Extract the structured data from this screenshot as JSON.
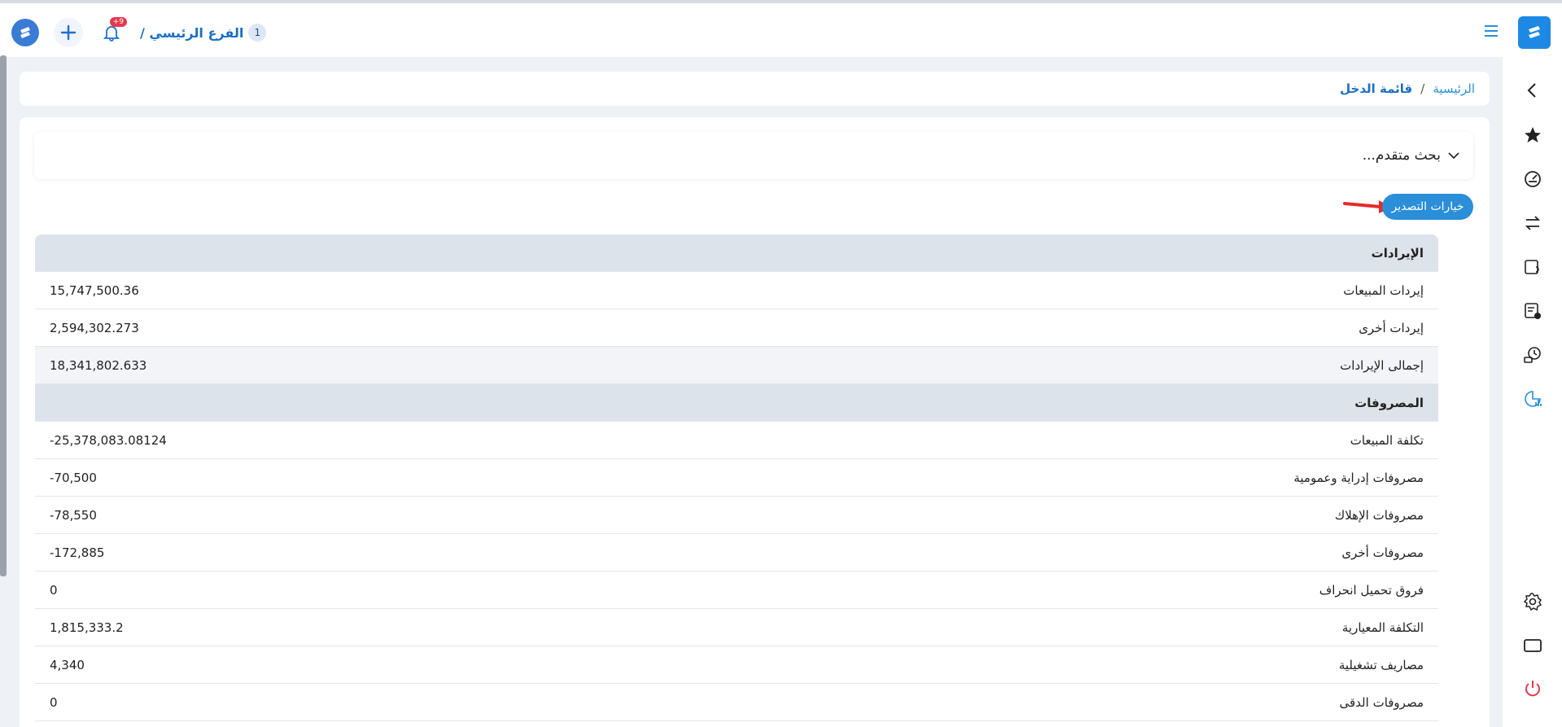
{
  "topbar": {
    "branch_label": "الفرع الرئيسي /",
    "branch_number": "1",
    "notification_badge": "+9"
  },
  "breadcrumb": {
    "home": "الرئيسية",
    "separator": "/",
    "current": "قائمة الدخل"
  },
  "search": {
    "advanced_label": "بحث متقدم..."
  },
  "export": {
    "label": "خيارات التصدير"
  },
  "table": {
    "rows": [
      {
        "type": "head",
        "label": "الإيرادات",
        "value": ""
      },
      {
        "type": "item",
        "label": "إيردات المبيعات",
        "value": "15,747,500.36"
      },
      {
        "type": "item",
        "label": "إيردات أخرى",
        "value": "2,594,302.273"
      },
      {
        "type": "total",
        "label": "إجمالى الإيرادات",
        "value": "18,341,802.633"
      },
      {
        "type": "head",
        "label": "المصروفات",
        "value": ""
      },
      {
        "type": "item",
        "label": "تكلفة المبيعات",
        "value": "-25,378,083.08124"
      },
      {
        "type": "item",
        "label": "مصروفات إدراية وعمومية",
        "value": "-70,500"
      },
      {
        "type": "item",
        "label": "مصروفات الإهلاك",
        "value": "-78,550"
      },
      {
        "type": "item",
        "label": "مصروفات أخرى",
        "value": "-172,885"
      },
      {
        "type": "item",
        "label": "فروق تحميل انحراف",
        "value": "0"
      },
      {
        "type": "item",
        "label": "التكلفة المعيارية",
        "value": "1,815,333.2"
      },
      {
        "type": "item",
        "label": "مصاريف تشغيلية",
        "value": "4,340"
      },
      {
        "type": "item",
        "label": "مصروفات الدقى",
        "value": "0"
      }
    ]
  },
  "colors": {
    "accent": "#2a8ed8",
    "brand": "#1e88e5",
    "danger": "#e53950"
  }
}
